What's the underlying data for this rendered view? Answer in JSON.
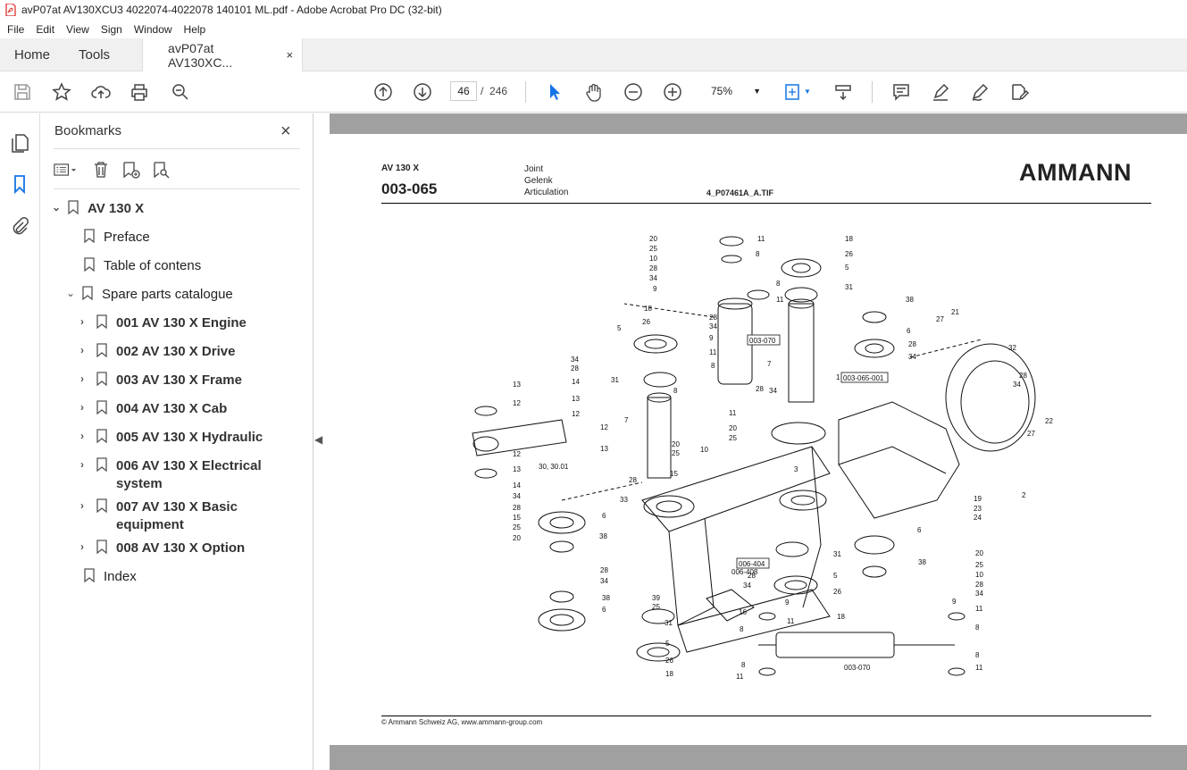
{
  "window": {
    "title": "avP07at AV130XCU3 4022074-4022078 140101 ML.pdf - Adobe Acrobat Pro DC (32-bit)"
  },
  "menu": [
    "File",
    "Edit",
    "View",
    "Sign",
    "Window",
    "Help"
  ],
  "tabs": {
    "home": "Home",
    "tools": "Tools",
    "document": "avP07at AV130XC...",
    "close": "×"
  },
  "toolbar": {
    "current_page": "46",
    "separator": "/",
    "total_pages": "246",
    "zoom": "75%"
  },
  "bookmarks": {
    "title": "Bookmarks",
    "close": "×",
    "root": "AV 130 X",
    "items": [
      {
        "label": "Preface"
      },
      {
        "label": "Table of contens"
      },
      {
        "label": "Spare parts catalogue"
      },
      {
        "label": "001 AV 130 X Engine"
      },
      {
        "label": "002 AV 130 X Drive"
      },
      {
        "label": "003 AV 130 X Frame"
      },
      {
        "label": "004 AV 130 X Cab"
      },
      {
        "label": "005 AV 130 X Hydraulic"
      },
      {
        "label": "006 AV 130 X Electrical",
        "label2": "system"
      },
      {
        "label": "007 AV 130 X Basic",
        "label2": "equipment"
      },
      {
        "label": "008 AV 130 X Option"
      },
      {
        "label": "Index"
      }
    ]
  },
  "document": {
    "model": "AV 130 X",
    "number": "003-065",
    "desc": [
      "Joint",
      "Gelenk",
      "Articulation"
    ],
    "file": "4_P07461A_A.TIF",
    "logo": "AMMANN",
    "footer": "© Ammann Schweiz AG, www.ammann-group.com",
    "refs": [
      "003-070",
      "003-065-001",
      "006-404",
      "006-408",
      "003-070",
      "30, 30.01"
    ]
  }
}
